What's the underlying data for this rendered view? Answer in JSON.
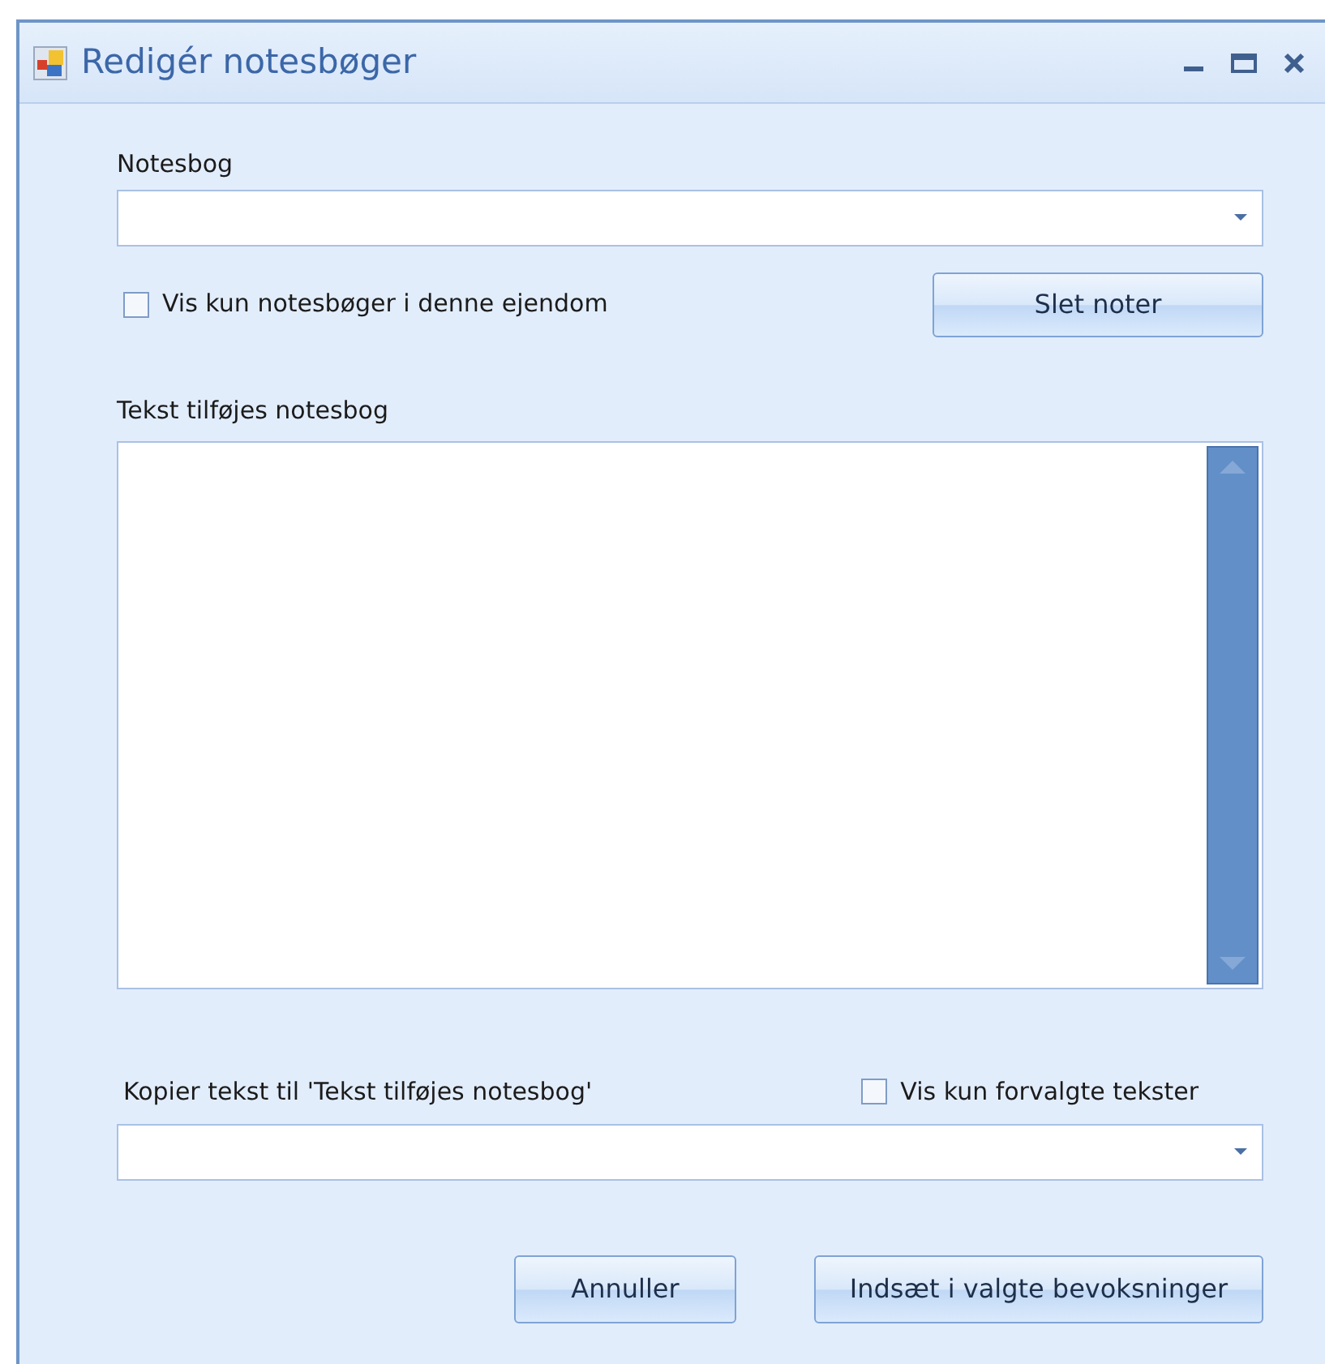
{
  "window": {
    "title": "Redigér notesbøger"
  },
  "notebook": {
    "label": "Notesbog"
  },
  "only_property": {
    "label": "Vis kun notesbøger i denne ejendom",
    "checked": false
  },
  "delete_button": "Slet noter",
  "text": {
    "label": "Tekst tilføjes notesbog"
  },
  "copy": {
    "label": "Kopier tekst til 'Tekst tilføjes notesbog'"
  },
  "only_preset": {
    "label": "Vis kun forvalgte tekster",
    "checked": false
  },
  "buttons": [
    {
      "label": "Annuller"
    },
    {
      "label": "Indsæt i valgte bevoksninger"
    }
  ]
}
